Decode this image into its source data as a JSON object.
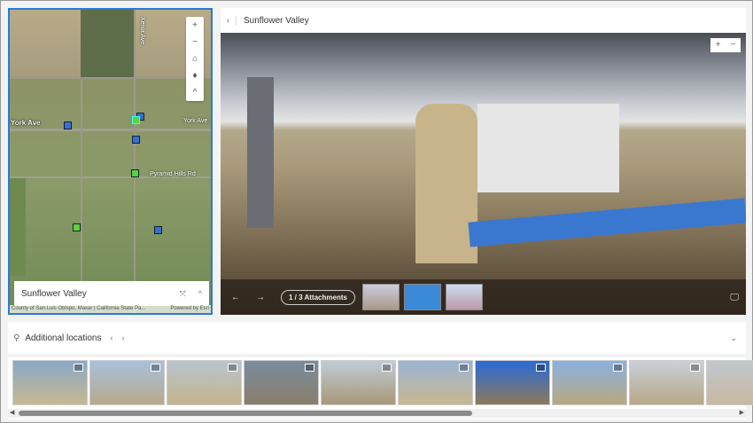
{
  "map": {
    "roads": [
      "Xenia Ave",
      "York Ave",
      "York Ave",
      "Pyramid Hills Rd"
    ],
    "controls": {
      "zoom_in": "+",
      "zoom_out": "−",
      "home": "⌂",
      "compass": "♦",
      "collapse": "^"
    },
    "card_title": "Sunflower Valley",
    "attribution": "County of San Luis Obispo, Maxar | California State Pa...",
    "powered_by": "Powered by Esri"
  },
  "detail": {
    "title": "Sunflower Valley",
    "back": "‹",
    "zoom_in": "+",
    "zoom_out": "−",
    "attachments_label": "1 / 3 Attachments",
    "prev": "←",
    "next": "→",
    "fullscreen": "🖵"
  },
  "additional": {
    "title": "Additional locations",
    "prev": "‹",
    "next": "›",
    "collapse": "⌄"
  },
  "thumbnails_count": 10,
  "colors": {
    "accent": "#2b7bd3",
    "marker_blue": "#3a6fd0",
    "marker_green": "#5bd43a"
  }
}
